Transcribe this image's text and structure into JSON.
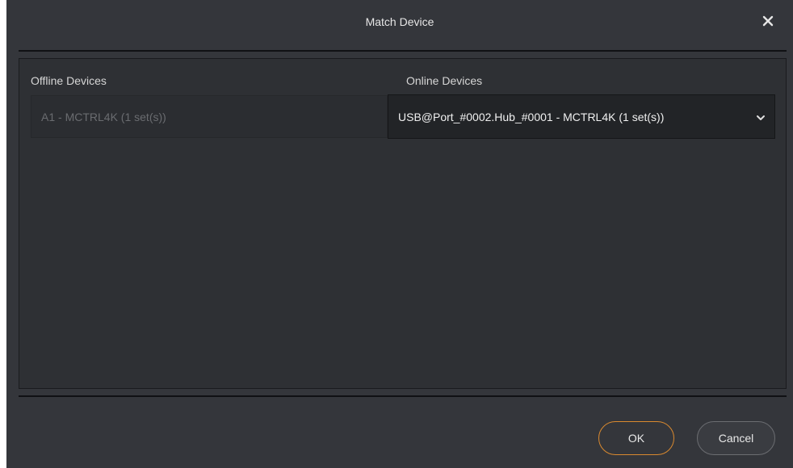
{
  "dialog": {
    "title": "Match Device",
    "close_icon": "close-icon"
  },
  "offline": {
    "label": "Offline Devices",
    "value": "A1 - MCTRL4K (1 set(s))"
  },
  "online": {
    "label": "Online Devices",
    "selected": "USB@Port_#0002.Hub_#0001 - MCTRL4K (1 set(s))",
    "icon": "chevron-down-icon"
  },
  "buttons": {
    "ok": "OK",
    "cancel": "Cancel"
  },
  "colors": {
    "background": "#34363b",
    "accent": "#d9892f"
  }
}
